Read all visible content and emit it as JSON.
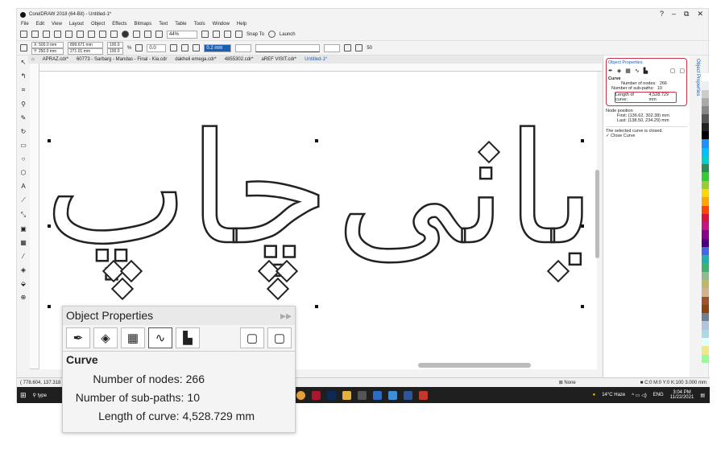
{
  "app": {
    "title": "CorelDRAW 2018 (64-Bit) - Untitled-1*",
    "window_buttons": [
      "?",
      "–",
      "⧉",
      "✕"
    ]
  },
  "menu": [
    "File",
    "Edit",
    "View",
    "Layout",
    "Object",
    "Effects",
    "Bitmaps",
    "Text",
    "Table",
    "Tools",
    "Window",
    "Help"
  ],
  "toolbar": {
    "zoom": "44%",
    "snap": "Snap To",
    "launch": "Launch"
  },
  "propbar": {
    "x": "X: 500.0 mm",
    "y": "Y: 250.0 mm",
    "w": "899.671 mm",
    "h": "271.01 mm",
    "sx": "100.0",
    "sy": "100.0",
    "pct": "%",
    "angle": "0.0",
    "outline": "0.2 mm",
    "nudge": "50"
  },
  "tabs": [
    "APRAZ.cdr*",
    "60773 - Sarbarg - Mandas - Final - Kia.cdr",
    "dakheli emega.cdr*",
    "4855302.cdr*",
    "aREF VISIT.cdr*",
    "Untitled-1*"
  ],
  "canvas": {
    "art_left": "بانی",
    "art_right": "چاپ"
  },
  "docker": {
    "title": "Object Properties",
    "section": "Curve",
    "nodes_label": "Number of nodes:",
    "nodes": "266",
    "subpaths_label": "Number of sub-paths:",
    "subpaths": "10",
    "length_label": "Length of curve:",
    "length": "4,528.729 mm",
    "node_position": "Node position",
    "first_label": "First:",
    "first": "(136.62, 302.38) mm",
    "last_label": "Last:",
    "last": "(138.50, 234.29) mm",
    "closed_text": "The selected curve is closed.",
    "close_curve": "Close Curve",
    "side_tab": "Object Properties"
  },
  "status": {
    "coords": "( 778.604, 137.318 )",
    "fill": "None",
    "outline": "C:0 M:0 Y:0 K:100 3.000 mm"
  },
  "taskbar": {
    "search": "type",
    "weather": "14°C Haze",
    "lang": "ENG",
    "time": "3:04 PM",
    "date": "11/22/2021"
  },
  "callout": {
    "title": "Object Properties",
    "section": "Curve",
    "nodes_label": "Number of nodes:",
    "nodes": "266",
    "subpaths_label": "Number of sub-paths:",
    "subpaths": "10",
    "length_label": "Length of curve:",
    "length": "4,528.729 mm"
  },
  "colors": {
    "highlight": "#c8334a",
    "accent": "#1a5fb4"
  }
}
